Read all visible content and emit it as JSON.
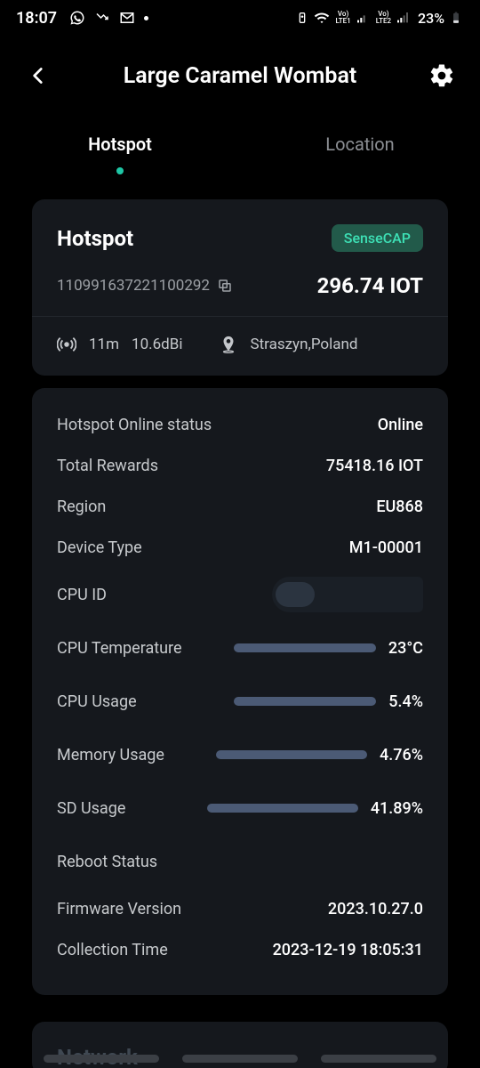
{
  "status": {
    "time": "18:07",
    "battery_pct": "23%",
    "lte1": "LTE1",
    "lte2": "LTE2",
    "volabel": "Vo)"
  },
  "header": {
    "title": "Large Caramel Wombat"
  },
  "tabs": {
    "hotspot": "Hotspot",
    "location": "Location"
  },
  "summary": {
    "title": "Hotspot",
    "badge": "SenseCAP",
    "device_id": "110991637221100292",
    "balance": "296.74 IOT",
    "elevation": "11m",
    "gain": "10.6dBi",
    "place": "Straszyn,Poland"
  },
  "details": {
    "online_status_label": "Hotspot Online status",
    "online_status_value": "Online",
    "total_rewards_label": "Total Rewards",
    "total_rewards_value": "75418.16 IOT",
    "region_label": "Region",
    "region_value": "EU868",
    "device_type_label": "Device Type",
    "device_type_value": "M1-00001",
    "cpu_id_label": "CPU ID",
    "cpu_temp_label": "CPU Temperature",
    "cpu_temp_value": "23°C",
    "cpu_temp_pct": 23,
    "cpu_usage_label": "CPU Usage",
    "cpu_usage_value": "5.4%",
    "cpu_usage_pct": 5.4,
    "mem_usage_label": "Memory Usage",
    "mem_usage_value": "4.76%",
    "mem_usage_pct": 4.76,
    "sd_usage_label": "SD Usage",
    "sd_usage_value": "41.89%",
    "sd_usage_pct": 41.89,
    "reboot_label": "Reboot Status",
    "firmware_label": "Firmware Version",
    "firmware_value": "2023.10.27.0",
    "collection_label": "Collection Time",
    "collection_value": "2023-12-19 18:05:31"
  },
  "network": {
    "title": "Network"
  }
}
